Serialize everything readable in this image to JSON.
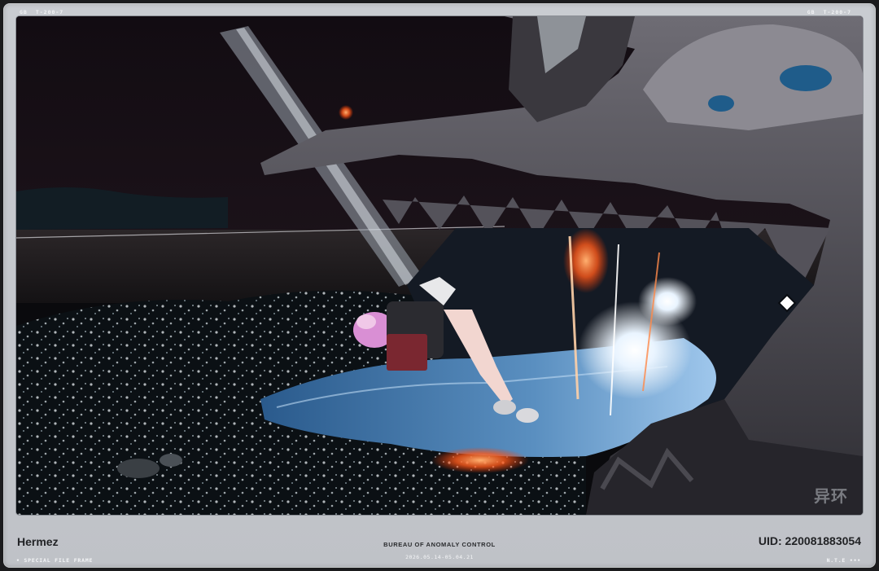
{
  "frame": {
    "top_left_tag": [
      "GB",
      "T-200-7"
    ],
    "top_right_tag": [
      "GB",
      "T-200-7"
    ],
    "player_name": "Hermez",
    "organization": "BUREAU OF ANOMALY CONTROL",
    "date_range": "2026.05.14-05.04.21",
    "uid": "UID: 220081883054",
    "footer_left": "• SPECIAL FILE FRAME",
    "footer_right": "N.T.E •••"
  },
  "screen": {
    "watermark": "异环"
  },
  "colors": {
    "frame_bg": "#c6c9ce",
    "accent_glow": "#ff6a2a",
    "water": "#2e5a8a"
  }
}
